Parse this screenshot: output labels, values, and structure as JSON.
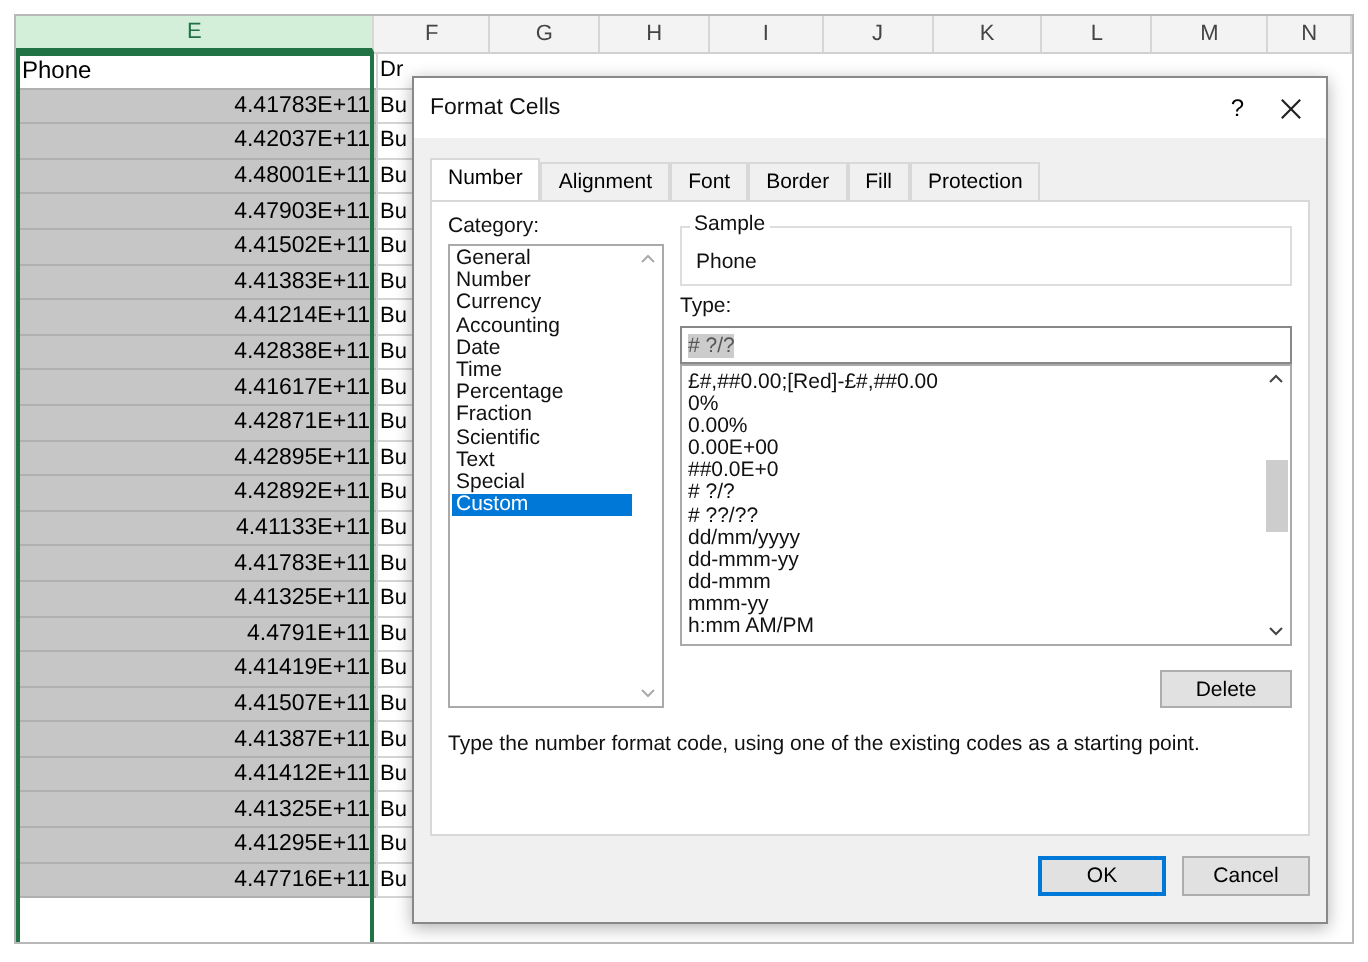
{
  "sheet": {
    "columns": [
      {
        "label": "E",
        "selected": true
      },
      {
        "label": "F",
        "selected": false
      },
      {
        "label": "G",
        "selected": false
      },
      {
        "label": "H",
        "selected": false
      },
      {
        "label": "I",
        "selected": false
      },
      {
        "label": "J",
        "selected": false
      },
      {
        "label": "K",
        "selected": false
      },
      {
        "label": "L",
        "selected": false
      },
      {
        "label": "M",
        "selected": false
      },
      {
        "label": "N",
        "selected": false
      }
    ],
    "header_row": {
      "column_e": "Phone",
      "column_f": "Dr"
    },
    "rows": [
      {
        "column_e": "4.41783E+11",
        "column_f": "Bu"
      },
      {
        "column_e": "4.42037E+11",
        "column_f": "Bu"
      },
      {
        "column_e": "4.48001E+11",
        "column_f": "Bu"
      },
      {
        "column_e": "4.47903E+11",
        "column_f": "Bu"
      },
      {
        "column_e": "4.41502E+11",
        "column_f": "Bu"
      },
      {
        "column_e": "4.41383E+11",
        "column_f": "Bu"
      },
      {
        "column_e": "4.41214E+11",
        "column_f": "Bu"
      },
      {
        "column_e": "4.42838E+11",
        "column_f": "Bu"
      },
      {
        "column_e": "4.41617E+11",
        "column_f": "Bu"
      },
      {
        "column_e": "4.42871E+11",
        "column_f": "Bu"
      },
      {
        "column_e": "4.42895E+11",
        "column_f": "Bu"
      },
      {
        "column_e": "4.42892E+11",
        "column_f": "Bu"
      },
      {
        "column_e": "4.41133E+11",
        "column_f": "Bu"
      },
      {
        "column_e": "4.41783E+11",
        "column_f": "Bu"
      },
      {
        "column_e": "4.41325E+11",
        "column_f": "Bu"
      },
      {
        "column_e": "4.4791E+11",
        "column_f": "Bu"
      },
      {
        "column_e": "4.41419E+11",
        "column_f": "Bu"
      },
      {
        "column_e": "4.41507E+11",
        "column_f": "Bu"
      },
      {
        "column_e": "4.41387E+11",
        "column_f": "Bu"
      },
      {
        "column_e": "4.41412E+11",
        "column_f": "Bu"
      },
      {
        "column_e": "4.41325E+11",
        "column_f": "Bu"
      },
      {
        "column_e": "4.41295E+11",
        "column_f": "Bu"
      },
      {
        "column_e": "4.47716E+11",
        "column_f": "Bu"
      }
    ]
  },
  "dialog": {
    "title": "Format Cells",
    "help": "?",
    "tabs": [
      {
        "label": "Number",
        "selected": true
      },
      {
        "label": "Alignment",
        "selected": false
      },
      {
        "label": "Font",
        "selected": false
      },
      {
        "label": "Border",
        "selected": false
      },
      {
        "label": "Fill",
        "selected": false
      },
      {
        "label": "Protection",
        "selected": false
      }
    ],
    "category_label": "Category:",
    "categories": [
      {
        "label": "General",
        "selected": false
      },
      {
        "label": "Number",
        "selected": false
      },
      {
        "label": "Currency",
        "selected": false
      },
      {
        "label": "Accounting",
        "selected": false
      },
      {
        "label": "Date",
        "selected": false
      },
      {
        "label": "Time",
        "selected": false
      },
      {
        "label": "Percentage",
        "selected": false
      },
      {
        "label": "Fraction",
        "selected": false
      },
      {
        "label": "Scientific",
        "selected": false
      },
      {
        "label": "Text",
        "selected": false
      },
      {
        "label": "Special",
        "selected": false
      },
      {
        "label": "Custom",
        "selected": true
      }
    ],
    "sample_label": "Sample",
    "sample_value": "Phone",
    "type_label": "Type:",
    "type_value": "# ?/?",
    "formats": [
      "£#,##0.00;[Red]-£#,##0.00",
      "0%",
      "0.00%",
      "0.00E+00",
      "##0.0E+0",
      "# ?/?",
      "# ??/??",
      "dd/mm/yyyy",
      "dd-mmm-yy",
      "dd-mmm",
      "mmm-yy",
      "h:mm AM/PM"
    ],
    "delete_button": "Delete",
    "description": "Type the number format code, using one of the existing codes as a starting point.",
    "buttons": [
      {
        "label": "OK",
        "default": true
      },
      {
        "label": "Cancel",
        "default": false
      }
    ]
  }
}
